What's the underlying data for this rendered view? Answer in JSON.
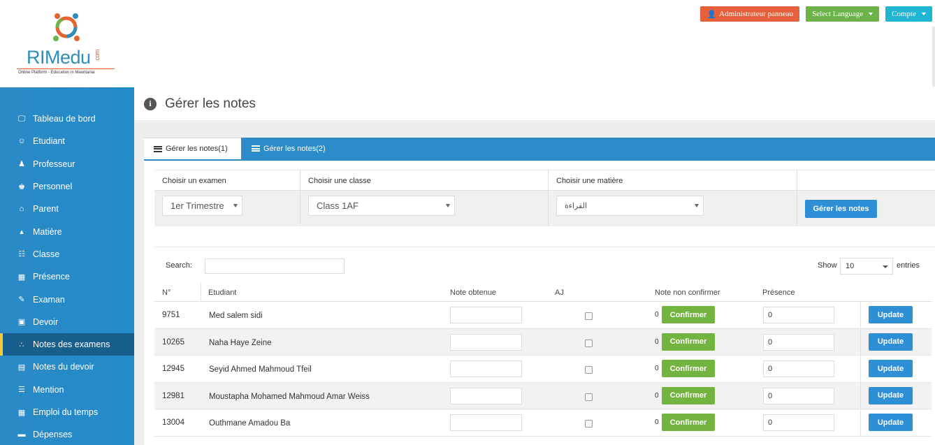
{
  "brand": {
    "name": "RIMedu",
    "suffix": "com",
    "tagline": "Online Platform - Education in Mauritania",
    "colors": {
      "blue": "#2a8fbd",
      "orange": "#e6632f"
    }
  },
  "topbar": {
    "admin_label": "Administrateur panneau",
    "language_label": "Select Language",
    "account_label": "Compte"
  },
  "sidebar": {
    "items": [
      {
        "label": "Tableau de bord",
        "icon": "monitor-icon"
      },
      {
        "label": "Etudiant",
        "icon": "student-icon"
      },
      {
        "label": "Professeur",
        "icon": "teacher-icon"
      },
      {
        "label": "Personnel",
        "icon": "staff-icon"
      },
      {
        "label": "Parent",
        "icon": "parent-icon"
      },
      {
        "label": "Matière",
        "icon": "graduation-cap-icon"
      },
      {
        "label": "Classe",
        "icon": "class-list-icon"
      },
      {
        "label": "Présence",
        "icon": "attendance-icon"
      },
      {
        "label": "Examan",
        "icon": "pencil-icon"
      },
      {
        "label": "Devoir",
        "icon": "book-icon"
      },
      {
        "label": "Notes des examens",
        "icon": "sitemap-icon"
      },
      {
        "label": "Notes du devoir",
        "icon": "notes-icon"
      },
      {
        "label": "Mention",
        "icon": "list-icon"
      },
      {
        "label": "Emploi du temps",
        "icon": "calendar-icon"
      },
      {
        "label": "Dépenses",
        "icon": "credit-card-icon"
      }
    ],
    "active_index": 10
  },
  "page": {
    "title": "Gérer les notes",
    "tabs": [
      {
        "label": "Gérer les notes(1)"
      },
      {
        "label": "Gérer les notes(2)"
      }
    ]
  },
  "filter": {
    "exam_label": "Choisir un examen",
    "class_label": "Choisir une classe",
    "subject_label": "Choisir une matière",
    "exam_value": "1er Trimestre",
    "class_value": "Class 1AF",
    "subject_value": "القراءة",
    "submit_label": "Gérer les notes"
  },
  "table_controls": {
    "search_label": "Search:",
    "show_label": "Show",
    "show_value": "10",
    "entries_label": "entries"
  },
  "table": {
    "headers": {
      "num": "N°",
      "student": "Etudiant",
      "note": "Note obtenue",
      "aj": "AJ",
      "unconfirmed": "Note non confirmer",
      "presence": "Présence"
    },
    "confirm_label": "Confirmer",
    "update_label": "Update",
    "rows": [
      {
        "num": "9751",
        "name": "Med salem sidi",
        "unconfirmed": "0",
        "presence": "0"
      },
      {
        "num": "10265",
        "name": "Naha Haye Zeine",
        "unconfirmed": "0",
        "presence": "0"
      },
      {
        "num": "12945",
        "name": "Seyid Ahmed Mahmoud Tfeil",
        "unconfirmed": "0",
        "presence": "0"
      },
      {
        "num": "12981",
        "name": "Moustapha Mohamed Mahmoud Amar Weiss",
        "unconfirmed": "0",
        "presence": "0"
      },
      {
        "num": "13004",
        "name": "Outhmane Amadou Ba",
        "unconfirmed": "0",
        "presence": "0"
      }
    ]
  }
}
